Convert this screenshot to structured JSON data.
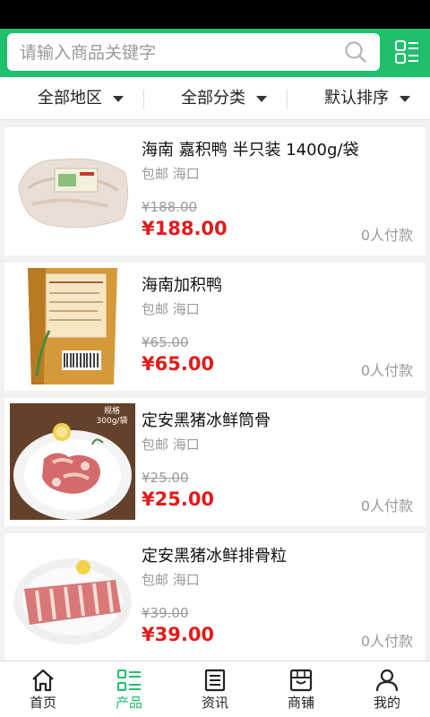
{
  "search": {
    "placeholder": "请输入商品关键字"
  },
  "filters": [
    {
      "label": "全部地区"
    },
    {
      "label": "全部分类"
    },
    {
      "label": "默认排序"
    }
  ],
  "products": [
    {
      "name": "海南 嘉积鸭 半只装 1400g/袋",
      "tag": "包邮 海口",
      "old_price": "¥188.00",
      "price": "¥188.00",
      "sold": "0人付款"
    },
    {
      "name": "海南加积鸭",
      "tag": "包邮 海口",
      "old_price": "¥65.00",
      "price": "¥65.00",
      "sold": "0人付款"
    },
    {
      "name": "定安黑猪冰鲜筒骨",
      "tag": "包邮 海口",
      "old_price": "¥25.00",
      "price": "¥25.00",
      "sold": "0人付款",
      "thumb_badge": "规格 300g/袋"
    },
    {
      "name": "定安黑猪冰鲜排骨粒",
      "tag": "包邮 海口",
      "old_price": "¥39.00",
      "price": "¥39.00",
      "sold": "0人付款"
    }
  ],
  "tabs": [
    {
      "label": "首页",
      "icon": "home-icon"
    },
    {
      "label": "产品",
      "icon": "product-list-icon"
    },
    {
      "label": "资讯",
      "icon": "news-icon"
    },
    {
      "label": "商铺",
      "icon": "shop-icon"
    },
    {
      "label": "我的",
      "icon": "user-icon"
    }
  ],
  "colors": {
    "brand": "#1fbf6b",
    "price": "#e21b1b",
    "muted": "#9a9a9a"
  }
}
